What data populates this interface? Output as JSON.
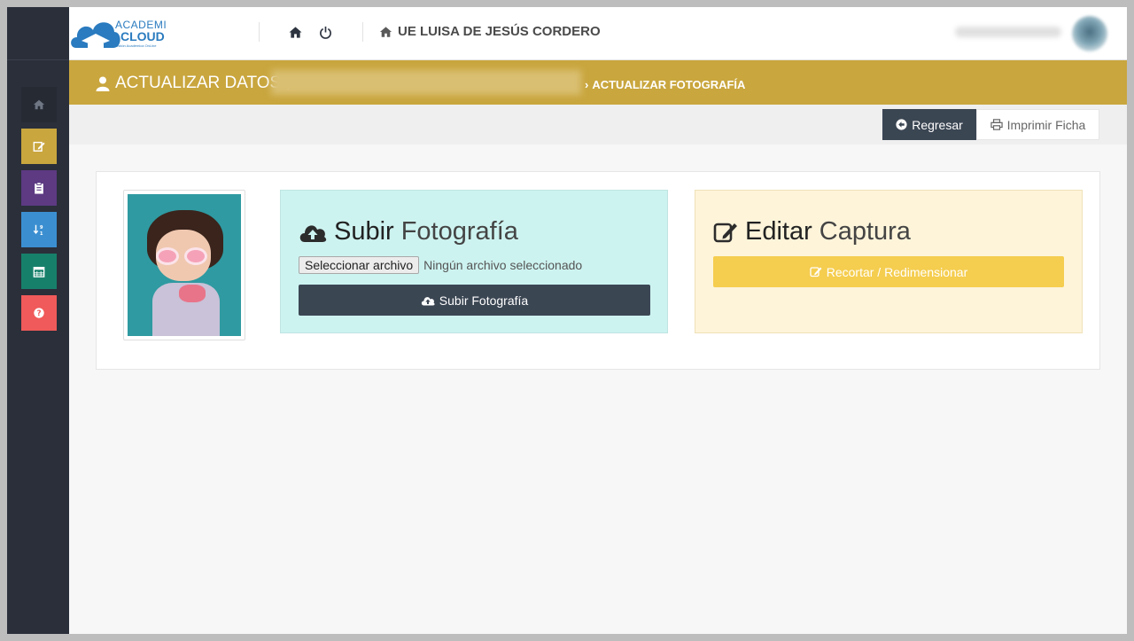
{
  "app": {
    "brand_line1": "ACADEMI",
    "brand_line2": "CLOUD",
    "brand_tagline": "Gestión Académica OnLine",
    "school_name": "UE LUISA DE JESÚS CORDERO"
  },
  "sidebar": {
    "items": [
      {
        "icon": "home-icon",
        "color": "#252a33"
      },
      {
        "icon": "edit-icon",
        "color": "#c9a63e"
      },
      {
        "icon": "clipboard-icon",
        "color": "#5d3a82"
      },
      {
        "icon": "sort-numeric-icon",
        "color": "#3b8fd1"
      },
      {
        "icon": "calendar-icon",
        "color": "#17806b"
      },
      {
        "icon": "help-icon",
        "color": "#f05a5a"
      }
    ]
  },
  "header": {
    "title": "ACTUALIZAR DATOS ,",
    "breadcrumb_separator": "›",
    "breadcrumb_current": "ACTUALIZAR FOTOGRAFÍA"
  },
  "toolbar": {
    "back_label": "Regresar",
    "print_label": "Imprimir Ficha"
  },
  "upload_panel": {
    "title_strong": "Subir",
    "title_light": "Fotografía",
    "file_button": "Seleccionar archivo",
    "file_status": "Ningún archivo seleccionado",
    "submit_label": "Subir Fotografía"
  },
  "edit_panel": {
    "title_strong": "Editar",
    "title_light": "Captura",
    "crop_label": "Recortar / Redimensionar"
  },
  "colors": {
    "gold": "#c9a63e",
    "dark": "#3b4653",
    "upload_bg": "#cdf3f0",
    "edit_bg": "#fdf4da",
    "crop_btn": "#f5cd4f"
  }
}
